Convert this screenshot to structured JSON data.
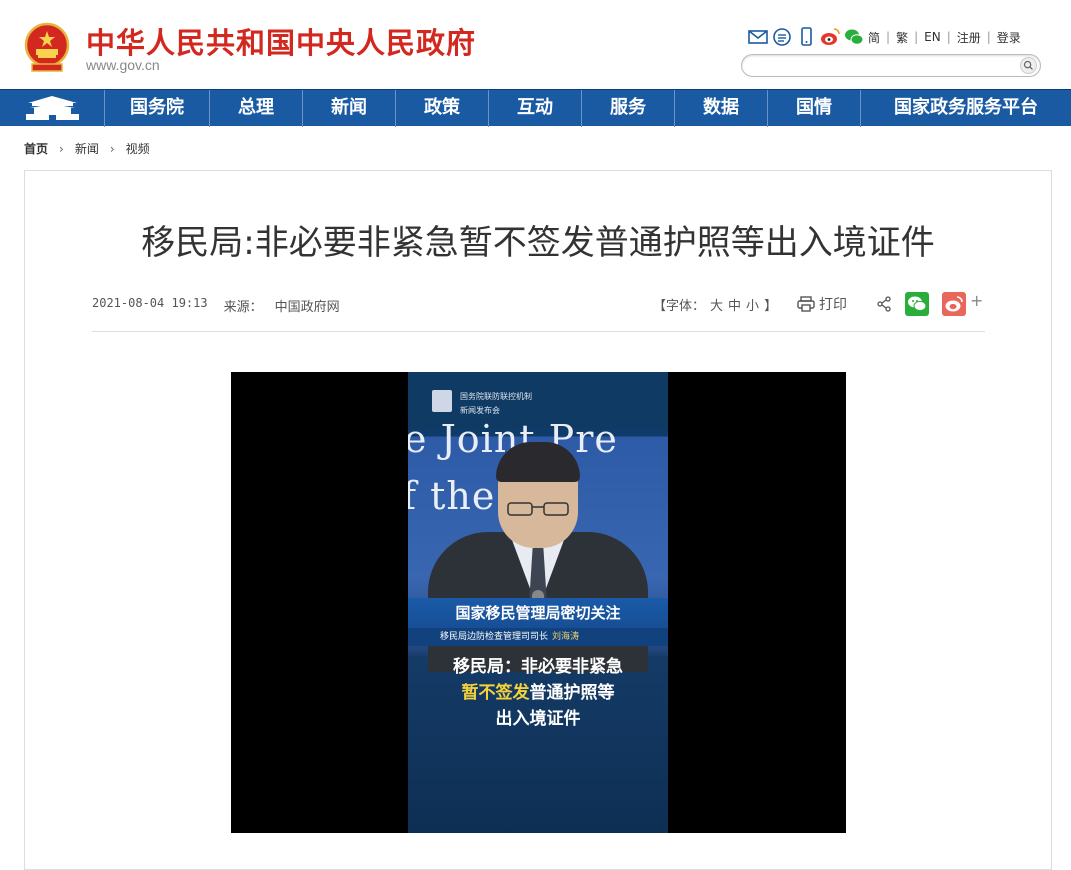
{
  "header": {
    "site_title": "中华人民共和国中央人民政府",
    "site_url": "www.gov.cn",
    "lang_links": [
      "简",
      "繁",
      "EN",
      "注册",
      "登录"
    ],
    "icons": [
      "mail-icon",
      "rss-icon",
      "mobile-icon",
      "weibo-icon",
      "wechat-icon"
    ],
    "search_placeholder": ""
  },
  "nav": {
    "items": [
      "国务院",
      "总理",
      "新闻",
      "政策",
      "互动",
      "服务",
      "数据",
      "国情",
      "国家政务服务平台"
    ]
  },
  "breadcrumb": [
    "首页",
    "新闻",
    "视频"
  ],
  "article": {
    "title": "移民局:非必要非紧急暂不签发普通护照等出入境证件",
    "date": "2021-08-04 19:13",
    "source_label": "来源：",
    "source": "中国政府网",
    "font_size_label": "【字体：",
    "font_sizes": [
      "大",
      "中",
      "小"
    ],
    "font_size_close": "】",
    "print_label": "打印",
    "share_plus": "+"
  },
  "video": {
    "org_line1": "国务院联防联控机制",
    "org_line2": "新闻发布会",
    "backdrop_line1": "e Joint Pre",
    "backdrop_line2": "f  the  Sta",
    "band_text": "国家移民管理局密切关注",
    "speaker_title": "移民局边防检查管理司司长",
    "speaker_name": "刘海涛",
    "caption_line1": "移民局：非必要非紧急",
    "caption_line2_highlight": "暂不签发",
    "caption_line2_rest": "普通护照等",
    "caption_line3": "出入境证件"
  },
  "colors": {
    "brand_red": "#d3281f",
    "nav_blue": "#1a5aa3",
    "wechat_green": "#2aae3b",
    "weibo_red": "#e8665a",
    "caption_yellow": "#f5d23a"
  }
}
